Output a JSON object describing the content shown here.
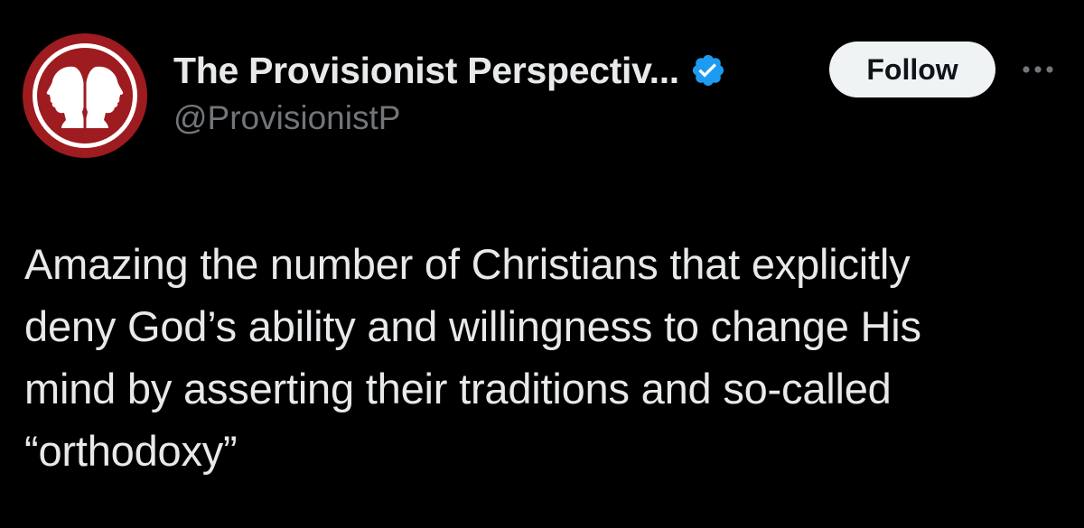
{
  "account": {
    "display_name": "The Provisionist Perspectiv...",
    "handle": "@ProvisionistP",
    "verified": true,
    "avatar_icon": "two-silhouette-profiles-icon",
    "avatar_colors": {
      "ring": "#9e1b1f",
      "inner": "#ffffff",
      "center": "#9e1b1f"
    }
  },
  "actions": {
    "follow_label": "Follow",
    "more_icon": "more-horizontal-icon"
  },
  "tweet": {
    "text": "Amazing the number of Christians that explicitly\ndeny God’s ability and willingness to change His\nmind by asserting their traditions and so-called\n“orthodoxy”"
  },
  "colors": {
    "background": "#000000",
    "primary_text": "#e7e9ea",
    "secondary_text": "#71767b",
    "verified_badge": "#1d9bf0",
    "follow_bg": "#eff3f4",
    "follow_text": "#0f1419"
  }
}
